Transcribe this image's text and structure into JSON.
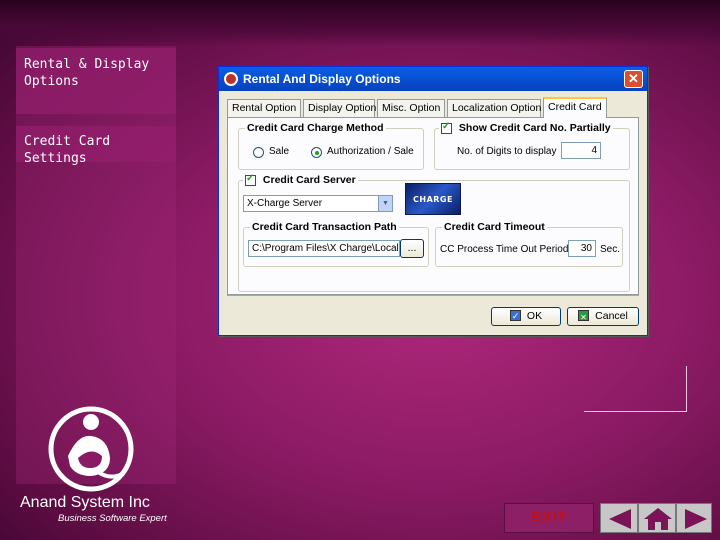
{
  "sidebar": {
    "items": [
      {
        "label": "Rental & Display Options"
      },
      {
        "label": "Credit Card Settings"
      }
    ]
  },
  "company": {
    "name": "Anand System Inc",
    "tagline": "Business Software Expert"
  },
  "dialog": {
    "title": "Rental And Display Options",
    "close_label": "✕",
    "tabs": [
      {
        "label": "Rental Option",
        "active": false
      },
      {
        "label": "Display Option",
        "active": false
      },
      {
        "label": "Misc. Option",
        "active": false
      },
      {
        "label": "Localization Option",
        "active": false
      },
      {
        "label": "Credit Card",
        "active": true
      }
    ],
    "charge_method": {
      "label": "Credit Card Charge Method",
      "options": [
        {
          "label": "Sale",
          "selected": false
        },
        {
          "label": "Authorization / Sale",
          "selected": true
        }
      ]
    },
    "show_partially": {
      "label": "Show Credit Card No. Partially",
      "checked": true,
      "digits_label": "No. of Digits to display",
      "digits_value": "4"
    },
    "server": {
      "label": "Credit Card Server",
      "checked": true,
      "selected": "X-Charge Server",
      "logo_text": "CHARGE"
    },
    "transaction_path": {
      "label": "Credit Card Transaction Path",
      "value": "C:\\Program Files\\X Charge\\Local",
      "browse_label": "..."
    },
    "timeout": {
      "label": "Credit Card Timeout",
      "field_label": "CC Process Time Out Period",
      "value": "30",
      "unit": "Sec."
    },
    "ok_label": "OK",
    "cancel_label": "Cancel"
  },
  "nav": {
    "exit_label": "EXIT",
    "prev_icon": "left-arrow-icon",
    "home_icon": "home-icon",
    "next_icon": "right-arrow-icon"
  },
  "colors": {
    "background": "#8a1a63",
    "sidebar": "#96206e",
    "exit_text": "#c0101a",
    "titlebar": "#0852d6"
  }
}
